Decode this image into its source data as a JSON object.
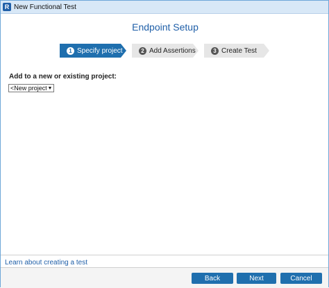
{
  "window": {
    "title": "New Functional Test",
    "icon_letter": "R"
  },
  "page": {
    "heading": "Endpoint Setup"
  },
  "steps": [
    {
      "number": "1",
      "label": "Specify project",
      "active": true
    },
    {
      "number": "2",
      "label": "Add Assertions",
      "active": false
    },
    {
      "number": "3",
      "label": "Create Test",
      "active": false
    }
  ],
  "project": {
    "label": "Add to a new or existing project:",
    "selected": "<New project>"
  },
  "footer": {
    "learn_link": "Learn about creating a test",
    "back_label": "Back",
    "next_label": "Next",
    "cancel_label": "Cancel"
  },
  "colors": {
    "accent": "#1f6fae",
    "heading": "#1f5fa8",
    "inactive_step": "#e6e6e6"
  }
}
